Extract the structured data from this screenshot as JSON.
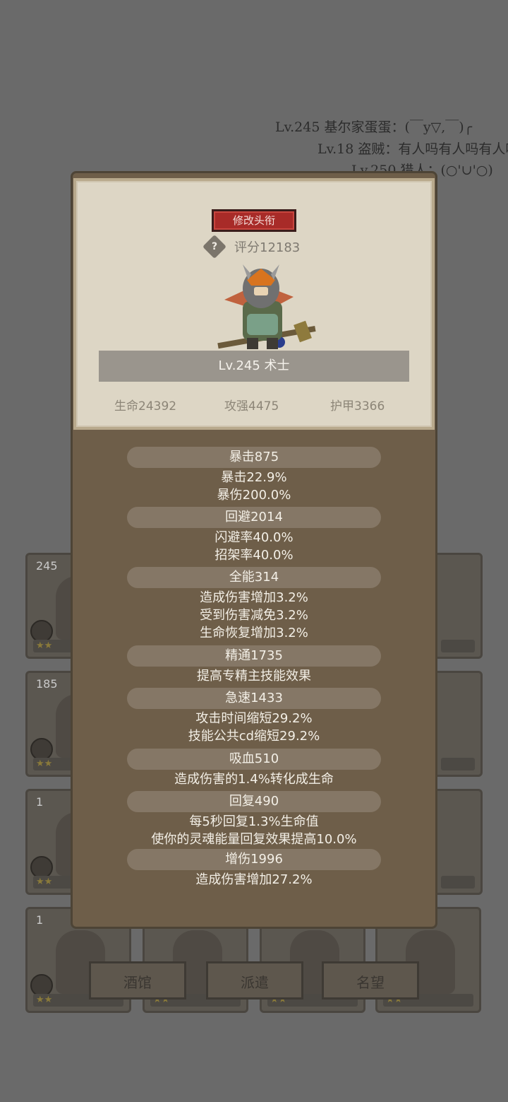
{
  "chat": [
    "Lv.245 基尔家蛋蛋：(￣y▽,￣)╭",
    "Lv.18 盗贼：有人吗有人吗有人吗",
    "Lv.250 猎人：(○'∪'○)"
  ],
  "background_cards": [
    {
      "level": "245"
    },
    {
      "level": "185"
    },
    {
      "level": "1"
    },
    {
      "level": "1"
    }
  ],
  "bottom_buttons": [
    "酒馆",
    "派遣",
    "名望"
  ],
  "header": {
    "title_button": "修改头衔",
    "help_icon": "?",
    "score": "评分12183",
    "name": "Lv.245 术士",
    "stats": {
      "hp": "生命24392",
      "atk": "攻强4475",
      "armor": "护甲3366"
    }
  },
  "attributes": [
    {
      "header": "暴击875",
      "lines": [
        "暴击22.9%",
        "暴伤200.0%"
      ]
    },
    {
      "header": "回避2014",
      "lines": [
        "闪避率40.0%",
        "招架率40.0%"
      ]
    },
    {
      "header": "全能314",
      "lines": [
        "造成伤害增加3.2%",
        "受到伤害减免3.2%",
        "生命恢复增加3.2%"
      ]
    },
    {
      "header": "精通1735",
      "lines": [
        "提高专精主技能效果"
      ]
    },
    {
      "header": "急速1433",
      "lines": [
        "攻击时间缩短29.2%",
        "技能公共cd缩短29.2%"
      ]
    },
    {
      "header": "吸血510",
      "lines": [
        "造成伤害的1.4%转化成生命"
      ]
    },
    {
      "header": "回复490",
      "lines": [
        "每5秒回复1.3%生命值",
        "使你的灵魂能量回复效果提高10.0%"
      ]
    },
    {
      "header": "增伤1996",
      "lines": [
        "造成伤害增加27.2%"
      ]
    }
  ]
}
